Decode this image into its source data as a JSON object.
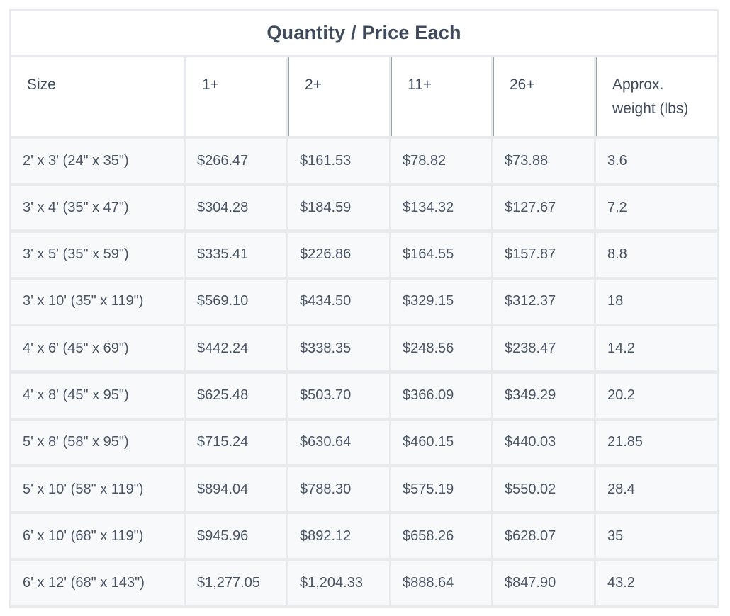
{
  "table": {
    "title": "Quantity / Price Each",
    "headers": [
      "Size",
      "1+",
      "2+",
      "11+",
      "26+",
      "Approx.\nweight (lbs)"
    ],
    "rows": [
      [
        "2' x 3' (24\" x 35\")",
        "$266.47",
        "$161.53",
        "$78.82",
        "$73.88",
        "3.6"
      ],
      [
        "3' x 4' (35\" x 47\")",
        "$304.28",
        "$184.59",
        "$134.32",
        "$127.67",
        "7.2"
      ],
      [
        "3' x 5' (35\" x 59\")",
        "$335.41",
        "$226.86",
        "$164.55",
        "$157.87",
        "8.8"
      ],
      [
        "3' x 10' (35\" x 119\")",
        "$569.10",
        "$434.50",
        "$329.15",
        "$312.37",
        "18"
      ],
      [
        "4' x 6' (45\" x 69\")",
        "$442.24",
        "$338.35",
        "$248.56",
        "$238.47",
        "14.2"
      ],
      [
        "4' x 8' (45\" x 95\")",
        "$625.48",
        "$503.70",
        "$366.09",
        "$349.29",
        "20.2"
      ],
      [
        "5' x 8' (58\" x 95\")",
        "$715.24",
        "$630.64",
        "$460.15",
        "$440.03",
        "21.85"
      ],
      [
        "5' x 10' (58\" x 119\")",
        "$894.04",
        "$788.30",
        "$575.19",
        "$550.02",
        "28.4"
      ],
      [
        "6' x 10' (68\" x 119\")",
        "$945.96",
        "$892.12",
        "$658.26",
        "$628.07",
        "35"
      ],
      [
        "6' x 12' (68\" x 143\")",
        "$1,277.05",
        "$1,204.33",
        "$888.64",
        "$847.90",
        "43.2"
      ]
    ]
  }
}
